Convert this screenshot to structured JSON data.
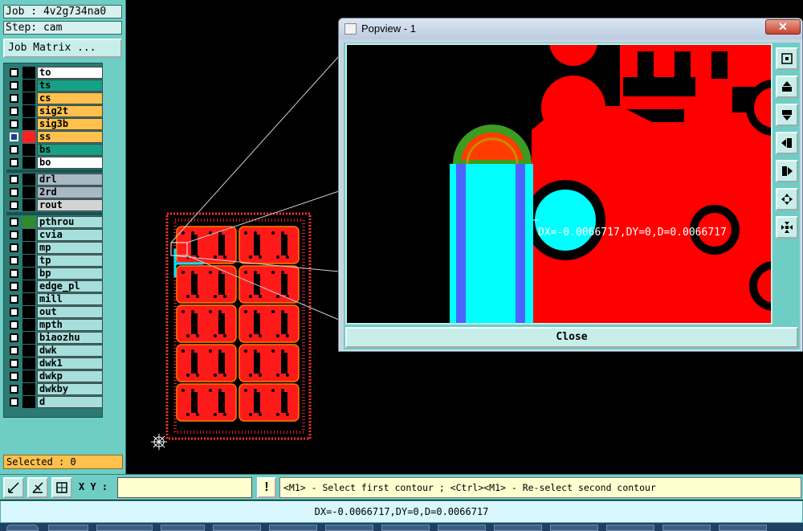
{
  "left_panel": {
    "job": "Job : 4v2g734na0",
    "step": "Step: cam",
    "job_matrix_label": "Job Matrix ...",
    "selected_label": "Selected : 0"
  },
  "layers": [
    {
      "name": "to",
      "name_bg": "#ffffff",
      "color": "#000000",
      "checked": false
    },
    {
      "name": "ts",
      "name_bg": "#16a085",
      "color": "#000000",
      "checked": false
    },
    {
      "name": "cs",
      "name_bg": "#ffc04d",
      "color": "#000000",
      "checked": false
    },
    {
      "name": "sig2t",
      "name_bg": "#ffc04d",
      "color": "#000000",
      "checked": false
    },
    {
      "name": "sig3b",
      "name_bg": "#ffc04d",
      "color": "#000000",
      "checked": false
    },
    {
      "name": "ss",
      "name_bg": "#ffc04d",
      "color": "#ff2020",
      "checked": true
    },
    {
      "name": "bs",
      "name_bg": "#16a085",
      "color": "#000000",
      "checked": false
    },
    {
      "name": "bo",
      "name_bg": "#ffffff",
      "color": "#000000",
      "checked": false
    },
    {
      "name": "drl",
      "name_bg": "#a8b8c4",
      "color": "#000000",
      "checked": false
    },
    {
      "name": "2rd",
      "name_bg": "#a8b8c4",
      "color": "#000000",
      "checked": false
    },
    {
      "name": "rout",
      "name_bg": "#d4d4d4",
      "color": "#000000",
      "checked": false
    },
    {
      "name": "pthrou",
      "name_bg": "#a6dfdc",
      "color": "#2e8b2e",
      "checked": false
    },
    {
      "name": "cvia",
      "name_bg": "#a6dfdc",
      "color": "#000000",
      "checked": false
    },
    {
      "name": "mp",
      "name_bg": "#a6dfdc",
      "color": "#000000",
      "checked": false
    },
    {
      "name": "tp",
      "name_bg": "#a6dfdc",
      "color": "#000000",
      "checked": false
    },
    {
      "name": "bp",
      "name_bg": "#a6dfdc",
      "color": "#000000",
      "checked": false
    },
    {
      "name": "edge_pl",
      "name_bg": "#a6dfdc",
      "color": "#000000",
      "checked": false
    },
    {
      "name": "mill",
      "name_bg": "#a6dfdc",
      "color": "#000000",
      "checked": false
    },
    {
      "name": "out",
      "name_bg": "#a6dfdc",
      "color": "#000000",
      "checked": false
    },
    {
      "name": "mpth",
      "name_bg": "#a6dfdc",
      "color": "#000000",
      "checked": false
    },
    {
      "name": "biaozhu",
      "name_bg": "#a6dfdc",
      "color": "#000000",
      "checked": false
    },
    {
      "name": "dwk",
      "name_bg": "#a6dfdc",
      "color": "#000000",
      "checked": false
    },
    {
      "name": "dwk1",
      "name_bg": "#a6dfdc",
      "color": "#000000",
      "checked": false
    },
    {
      "name": "dwkp",
      "name_bg": "#a6dfdc",
      "color": "#000000",
      "checked": false
    },
    {
      "name": "dwkby",
      "name_bg": "#a6dfdc",
      "color": "#000000",
      "checked": false
    },
    {
      "name": "d",
      "name_bg": "#a6dfdc",
      "color": "#000000",
      "checked": false
    }
  ],
  "toolbar": {
    "xy_label": "X Y :",
    "xy_value": "",
    "alert_label": "!",
    "prompt": "<M1> - Select first contour ; <Ctrl><M1> - Re-select second contour"
  },
  "status": {
    "measurement": "DX=-0.0066717,DY=0,D=0.0066717"
  },
  "popview": {
    "title": "Popview - 1",
    "close_x": "✕",
    "measure_overlay": "DX=-0.0066717,DY=0,D=0.0066717",
    "close_label": "Close",
    "tools": [
      "zoom-fit-icon",
      "pan-up-icon",
      "pan-down-icon",
      "pan-left-icon",
      "pan-right-icon",
      "zoom-in-icon",
      "zoom-out-icon"
    ]
  },
  "colors": {
    "panel": "#6ecdc4",
    "copper": "#ff0000",
    "highlight": "#00ffff",
    "prompt_bg": "#ffffd0"
  }
}
